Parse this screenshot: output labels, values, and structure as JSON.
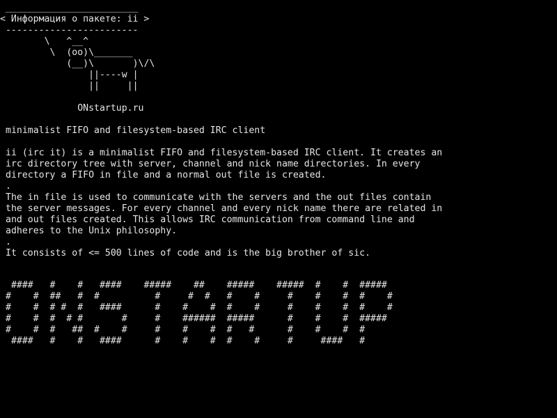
{
  "terminal": {
    "background": "#000000",
    "foreground": "#e6e6e6"
  },
  "banner": {
    "top_rule": " ________________________",
    "title": "< Информация о пакете: ii >",
    "bottom_rule": " ------------------------"
  },
  "cow": [
    "       \\   ^__^",
    "        \\  (oo)\\_______",
    "           (__)\\       )\\/\\",
    "               ||----w |",
    "               ||     ||"
  ],
  "site": "             ONstartup.ru",
  "package": {
    "short_description": "minimalist FIFO and filesystem-based IRC client",
    "long_description": [
      "ii (irc it) is a minimalist FIFO and filesystem-based IRC client. It creates an",
      "irc directory tree with server, channel and nick name directories. In every",
      "directory a FIFO in file and a normal out file is created.",
      ".",
      "The in file is used to communicate with the servers and the out files contain",
      "the server messages. For every channel and every nick name there are related in",
      "and out files created. This allows IRC communication from command line and",
      "adheres to the Unix philosophy.",
      ".",
      "It consists of <= 500 lines of code and is the big brother of sic."
    ]
  },
  "big_text": [
    " ####   #    #   ####    #####    ##    #####    #####  #    #  #####",
    "#    #  ##   #  #          #     #  #   #    #     #    #    #  #    #",
    "#    #  # #  #   ####      #    #    #  #    #     #    #    #  #    #",
    "#    #  #  # #       #     #    ######  #####      #    #    #  #####",
    "#    #  #   ##  #    #     #    #    #  #   #      #    #    #  #",
    " ####   #    #   ####      #    #    #  #    #     #     ####   #"
  ]
}
